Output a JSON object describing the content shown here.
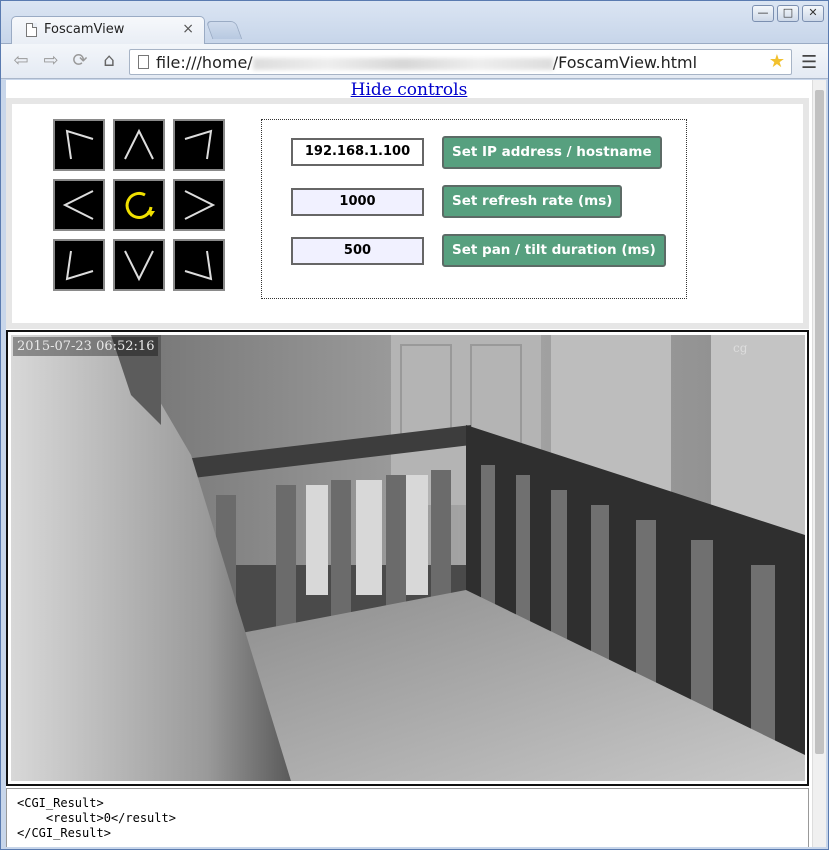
{
  "browser": {
    "tab_title": "FoscamView",
    "tab_close": "×",
    "url_prefix": "file:///home/",
    "url_suffix": "/FoscamView.html",
    "window_buttons": [
      "—",
      "□",
      "✕"
    ]
  },
  "page": {
    "hide_controls_link": "Hide controls",
    "pan_tilt_buttons": [
      "up-left",
      "up",
      "up-right",
      "left",
      "center-refresh",
      "right",
      "down-left",
      "down",
      "down-right"
    ],
    "settings": {
      "ip_value": "192.168.1.100",
      "ip_button": "Set IP address / hostname",
      "refresh_value": "1000",
      "refresh_button": "Set refresh rate (ms)",
      "duration_value": "500",
      "duration_button": "Set pan / tilt duration (ms)"
    },
    "camera": {
      "timestamp": "2015-07-23  06:52:16",
      "overlay_text": "cg"
    },
    "cgi_result": {
      "line1": "<CGI_Result>",
      "line2": "    <result>0</result>",
      "line3": "</CGI_Result>"
    }
  },
  "colors": {
    "button_green": "#57a07f",
    "input_bg": "#f1f1ff",
    "refresh_icon": "#f0e000",
    "link": "#0000cc"
  }
}
